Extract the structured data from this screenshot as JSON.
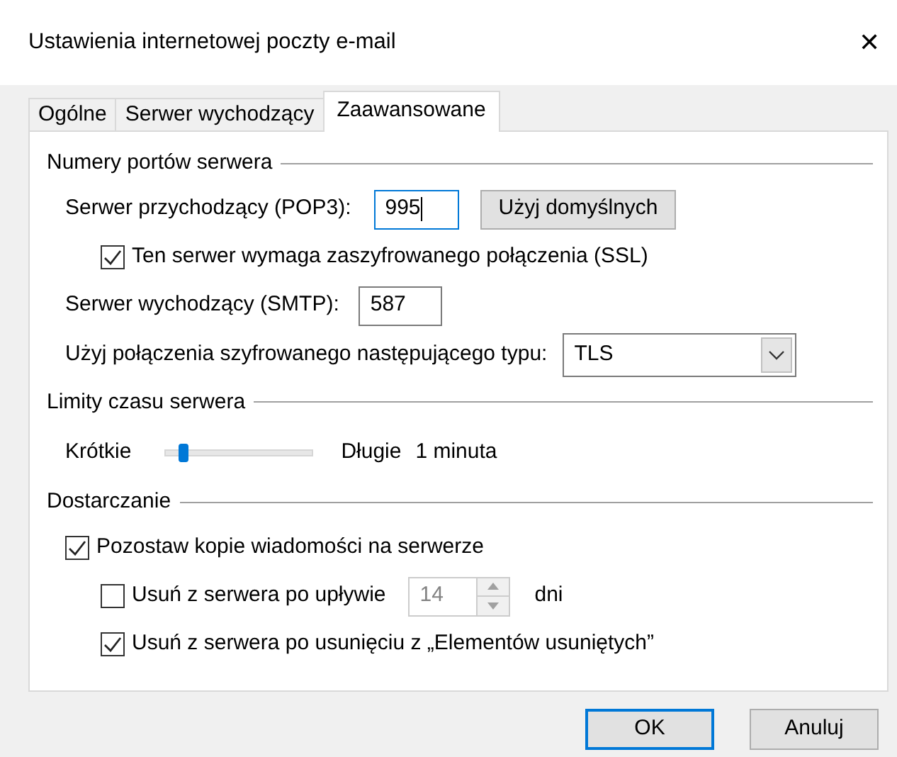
{
  "window": {
    "title": "Ustawienia internetowej poczty e-mail",
    "close": "✕"
  },
  "tabs": [
    {
      "label": "Ogólne",
      "selected": false
    },
    {
      "label": "Serwer wychodzący",
      "selected": false
    },
    {
      "label": "Zaawansowane",
      "selected": true
    }
  ],
  "sections": [
    {
      "title": "Numery portów serwera",
      "rows": [
        {
          "kind": "port",
          "label": "Serwer przychodzący (POP3):",
          "value": "995",
          "focused": true,
          "button": "Użyj domyślnych"
        },
        {
          "kind": "checkbox",
          "label": "Ten serwer wymaga zaszyfrowanego połączenia (SSL)",
          "checked": true,
          "indent": true
        },
        {
          "kind": "port",
          "label": "Serwer wychodzący (SMTP):",
          "value": "587",
          "focused": false
        },
        {
          "kind": "select",
          "label": "Użyj połączenia szyfrowanego następującego typu:",
          "value": "TLS"
        }
      ]
    },
    {
      "title": "Limity czasu serwera",
      "rows": [
        {
          "kind": "slider",
          "min_label": "Krótkie",
          "max_label": "Długie",
          "level": 0.1,
          "reading": "1 minuta"
        }
      ]
    },
    {
      "title": "Dostarczanie",
      "rows": [
        {
          "kind": "checkbox",
          "label": "Pozostaw kopie wiadomości na serwerze",
          "checked": true,
          "indent": false,
          "children": [
            {
              "kind": "spin",
              "label": "Usuń z serwera po upływie",
              "checked": false,
              "value": "14",
              "disabled": true,
              "unit": "dni"
            },
            {
              "kind": "checkbox",
              "label": "Usuń z serwera po usunięciu z „Elementów usuniętych”",
              "checked": true
            }
          ]
        }
      ]
    }
  ],
  "buttons": [
    {
      "label": "OK",
      "default": true
    },
    {
      "label": "Anuluj",
      "default": false
    }
  ]
}
